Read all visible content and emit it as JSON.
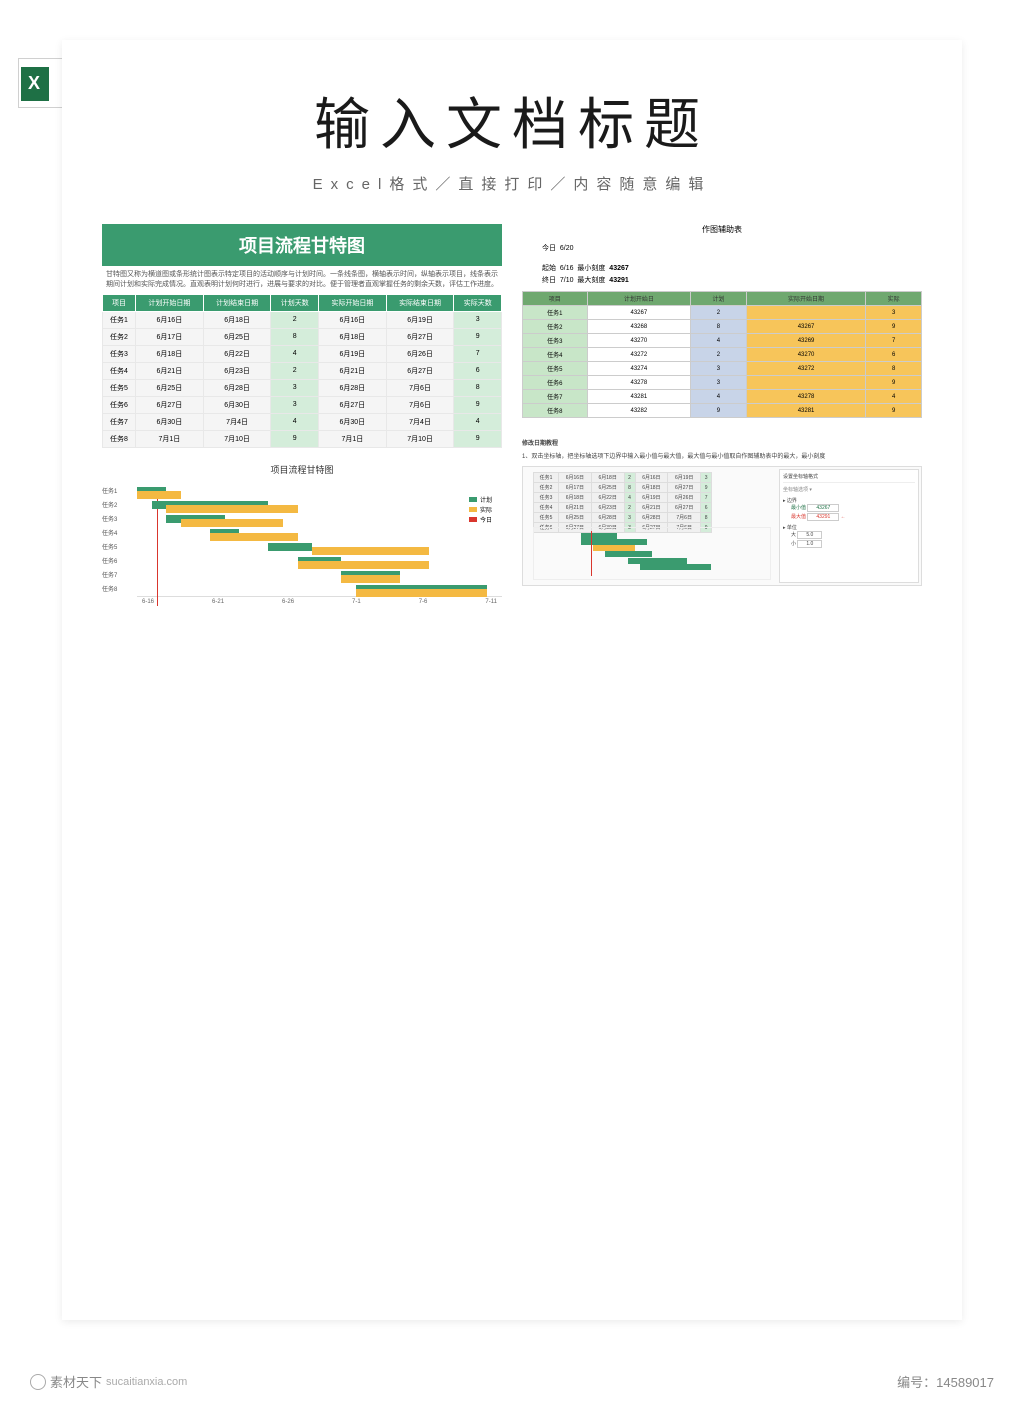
{
  "header": {
    "doc_title": "输入文档标题",
    "subtitle": "Excel格式／直接打印／内容随意编辑"
  },
  "main_gantt": {
    "title": "项目流程甘特图",
    "description": "甘特图又称为横道图或条形统计图表示特定项目的活动顺序与计划时间。一条线条图，横轴表示时间，纵轴表示项目，线条表示期间计划和实际完成情况。直观表明计划何时进行，进展与要求的对比。便于管理者直观掌握任务的剩余天数，评估工作进度。",
    "columns": [
      "项目",
      "计划开始日期",
      "计划结束日期",
      "计划天数",
      "实际开始日期",
      "实际结束日期",
      "实际天数"
    ],
    "rows": [
      [
        "任务1",
        "6月16日",
        "6月18日",
        "2",
        "6月16日",
        "6月19日",
        "3"
      ],
      [
        "任务2",
        "6月17日",
        "6月25日",
        "8",
        "6月18日",
        "6月27日",
        "9"
      ],
      [
        "任务3",
        "6月18日",
        "6月22日",
        "4",
        "6月19日",
        "6月26日",
        "7"
      ],
      [
        "任务4",
        "6月21日",
        "6月23日",
        "2",
        "6月21日",
        "6月27日",
        "6"
      ],
      [
        "任务5",
        "6月25日",
        "6月28日",
        "3",
        "6月28日",
        "7月6日",
        "8"
      ],
      [
        "任务6",
        "6月27日",
        "6月30日",
        "3",
        "6月27日",
        "7月6日",
        "9"
      ],
      [
        "任务7",
        "6月30日",
        "7月4日",
        "4",
        "6月30日",
        "7月4日",
        "4"
      ],
      [
        "任务8",
        "7月1日",
        "7月10日",
        "9",
        "7月1日",
        "7月10日",
        "9"
      ]
    ],
    "chart_title": "项目流程甘特图",
    "axis": [
      "6-16",
      "6-21",
      "6-26",
      "7-1",
      "7-6",
      "7-11"
    ],
    "task_labels": [
      "任务1",
      "任务2",
      "任务3",
      "任务4",
      "任务5",
      "任务6",
      "任务7",
      "任务8"
    ],
    "legend": {
      "a": "计划",
      "b": "实际",
      "c": "今日"
    }
  },
  "aux": {
    "title": "作图辅助表",
    "today_label": "今日",
    "today_value": "6/20",
    "start_label": "起始",
    "start_date": "6/16",
    "min_label": "最小刻度",
    "min_value": "43267",
    "end_label": "终日",
    "end_date": "7/10",
    "max_label": "最大刻度",
    "max_value": "43291",
    "columns": [
      "项目",
      "计划开始日",
      "计划",
      "实际开始日期",
      "实际"
    ],
    "rows": [
      [
        "任务1",
        "43267",
        "2",
        "",
        "3"
      ],
      [
        "任务2",
        "43268",
        "8",
        "43267",
        "9"
      ],
      [
        "任务3",
        "43270",
        "4",
        "43269",
        "7"
      ],
      [
        "任务4",
        "43272",
        "2",
        "43270",
        "6"
      ],
      [
        "任务5",
        "43274",
        "3",
        "43272",
        "8"
      ],
      [
        "任务6",
        "43278",
        "3",
        "",
        "9"
      ],
      [
        "任务7",
        "43281",
        "4",
        "43278",
        "4"
      ],
      [
        "任务8",
        "43282",
        "9",
        "43281",
        "9"
      ]
    ]
  },
  "instructions": {
    "heading": "修改日期教程",
    "text": "1、双击坐标轴，把坐标轴选项下边界中输入最小值与最大值，最大值与最小值取自作图辅助表中的最大，最小刻度"
  },
  "footer": {
    "site_brand": "素材天下",
    "site_domain": "sucaitianxia.com",
    "id_label": "编号：",
    "id_value": "14589017"
  },
  "chart_data": {
    "type": "bar",
    "title": "项目流程甘特图",
    "categories": [
      "任务1",
      "任务2",
      "任务3",
      "任务4",
      "任务5",
      "任务6",
      "任务7",
      "任务8"
    ],
    "x_axis_dates": [
      "6-16",
      "6-21",
      "6-26",
      "7-1",
      "7-6",
      "7-11"
    ],
    "series": [
      {
        "name": "计划开始",
        "values": [
          "6/16",
          "6/17",
          "6/18",
          "6/21",
          "6/25",
          "6/27",
          "6/30",
          "7/1"
        ]
      },
      {
        "name": "计划天数",
        "values": [
          2,
          8,
          4,
          2,
          3,
          3,
          4,
          9
        ]
      },
      {
        "name": "实际开始",
        "values": [
          "6/16",
          "6/18",
          "6/19",
          "6/21",
          "6/28",
          "6/27",
          "6/30",
          "7/1"
        ]
      },
      {
        "name": "实际天数",
        "values": [
          3,
          9,
          7,
          6,
          8,
          9,
          4,
          9
        ]
      }
    ],
    "today_marker": "6/20"
  }
}
